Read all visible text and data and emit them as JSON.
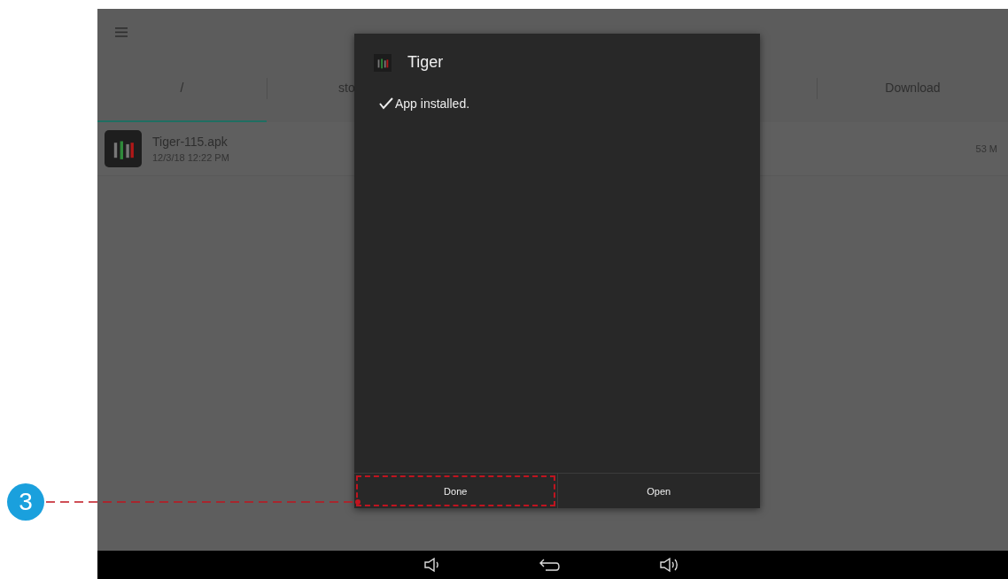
{
  "screen": {
    "tabs": [
      {
        "label": "/",
        "selected": true
      },
      {
        "label": "sto",
        "selected": false
      },
      {
        "label": "Download",
        "selected": false
      }
    ],
    "files": [
      {
        "name": "Tiger-115.apk",
        "date": "12/3/18 12:22 PM",
        "size": "53 M"
      }
    ],
    "dialog": {
      "title": "Tiger",
      "message": "App installed.",
      "buttons": [
        {
          "label": "Done",
          "highlighted": true
        },
        {
          "label": "Open",
          "highlighted": false
        }
      ]
    }
  },
  "callout": {
    "number": "3"
  }
}
